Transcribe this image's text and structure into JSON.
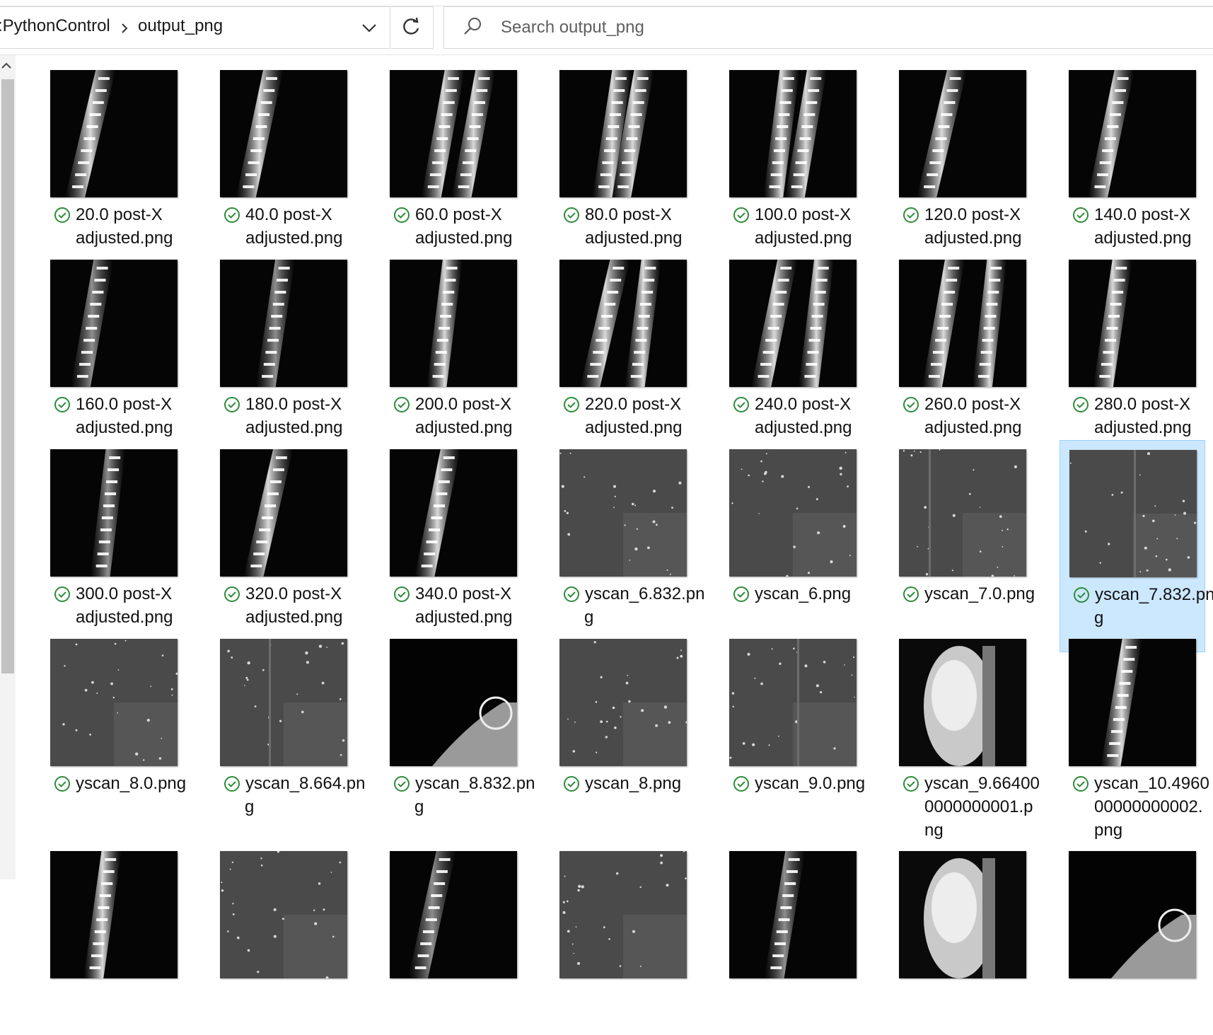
{
  "address_bar": {
    "path_partial": ":PythonControl",
    "current_folder": "output_png"
  },
  "search": {
    "placeholder": "Search output_png"
  },
  "colors": {
    "selection_bg": "#cce8ff",
    "sync_ok_green": "#2e8b3a"
  },
  "files": [
    {
      "line1": "20.0 post-X",
      "line2": "adjusted.png",
      "line3": "",
      "thumb": "spine-split"
    },
    {
      "line1": "40.0 post-X",
      "line2": "adjusted.png",
      "line3": "",
      "thumb": "spine-split"
    },
    {
      "line1": "60.0 post-X",
      "line2": "adjusted.png",
      "line3": "",
      "thumb": "spine-double"
    },
    {
      "line1": "80.0 post-X",
      "line2": "adjusted.png",
      "line3": "",
      "thumb": "spine-double"
    },
    {
      "line1": "100.0 post-X",
      "line2": "adjusted.png",
      "line3": "",
      "thumb": "spine-double"
    },
    {
      "line1": "120.0 post-X",
      "line2": "adjusted.png",
      "line3": "",
      "thumb": "spine-single"
    },
    {
      "line1": "140.0 post-X",
      "line2": "adjusted.png",
      "line3": "",
      "thumb": "spine-single"
    },
    {
      "line1": "160.0 post-X",
      "line2": "adjusted.png",
      "line3": "",
      "thumb": "spine-blur"
    },
    {
      "line1": "180.0 post-X",
      "line2": "adjusted.png",
      "line3": "",
      "thumb": "spine-blur"
    },
    {
      "line1": "200.0 post-X",
      "line2": "adjusted.png",
      "line3": "",
      "thumb": "spine-single"
    },
    {
      "line1": "220.0 post-X",
      "line2": "adjusted.png",
      "line3": "",
      "thumb": "spine-double"
    },
    {
      "line1": "240.0 post-X",
      "line2": "adjusted.png",
      "line3": "",
      "thumb": "spine-double"
    },
    {
      "line1": "260.0 post-X",
      "line2": "adjusted.png",
      "line3": "",
      "thumb": "spine-double"
    },
    {
      "line1": "280.0 post-X",
      "line2": "adjusted.png",
      "line3": "",
      "thumb": "spine-single"
    },
    {
      "line1": "300.0 post-X",
      "line2": "adjusted.png",
      "line3": "",
      "thumb": "spine-blur"
    },
    {
      "line1": "320.0 post-X",
      "line2": "adjusted.png",
      "line3": "",
      "thumb": "spine-single"
    },
    {
      "line1": "340.0 post-X",
      "line2": "adjusted.png",
      "line3": "",
      "thumb": "spine-single"
    },
    {
      "line1": "yscan_6.832.pn",
      "line2": "g",
      "line3": "",
      "thumb": "noise"
    },
    {
      "line1": "yscan_6.png",
      "line2": "",
      "line3": "",
      "thumb": "noise"
    },
    {
      "line1": "yscan_7.0.png",
      "line2": "",
      "line3": "",
      "thumb": "noise-line"
    },
    {
      "line1": "yscan_7.832.pn",
      "line2": "g",
      "line3": "",
      "thumb": "noise-line",
      "selected": true
    },
    {
      "line1": "yscan_8.0.png",
      "line2": "",
      "line3": "",
      "thumb": "noise"
    },
    {
      "line1": "yscan_8.664.pn",
      "line2": "g",
      "line3": "",
      "thumb": "noise-line"
    },
    {
      "line1": "yscan_8.832.pn",
      "line2": "g",
      "line3": "",
      "thumb": "dark-head"
    },
    {
      "line1": "yscan_8.png",
      "line2": "",
      "line3": "",
      "thumb": "noise"
    },
    {
      "line1": "yscan_9.0.png",
      "line2": "",
      "line3": "",
      "thumb": "noise-line"
    },
    {
      "line1": "yscan_9.66400",
      "line2": "0000000001.p",
      "line3": "ng",
      "thumb": "yolk"
    },
    {
      "line1": "yscan_10.4960",
      "line2": "00000000002.",
      "line3": "png",
      "thumb": "spine-single"
    },
    {
      "line1": "",
      "line2": "",
      "line3": "",
      "thumb": "spine-single"
    },
    {
      "line1": "",
      "line2": "",
      "line3": "",
      "thumb": "noise"
    },
    {
      "line1": "",
      "line2": "",
      "line3": "",
      "thumb": "spine-blur"
    },
    {
      "line1": "",
      "line2": "",
      "line3": "",
      "thumb": "noise"
    },
    {
      "line1": "",
      "line2": "",
      "line3": "",
      "thumb": "spine-blur"
    },
    {
      "line1": "",
      "line2": "",
      "line3": "",
      "thumb": "yolk"
    },
    {
      "line1": "",
      "line2": "",
      "line3": "",
      "thumb": "dark-head"
    }
  ]
}
